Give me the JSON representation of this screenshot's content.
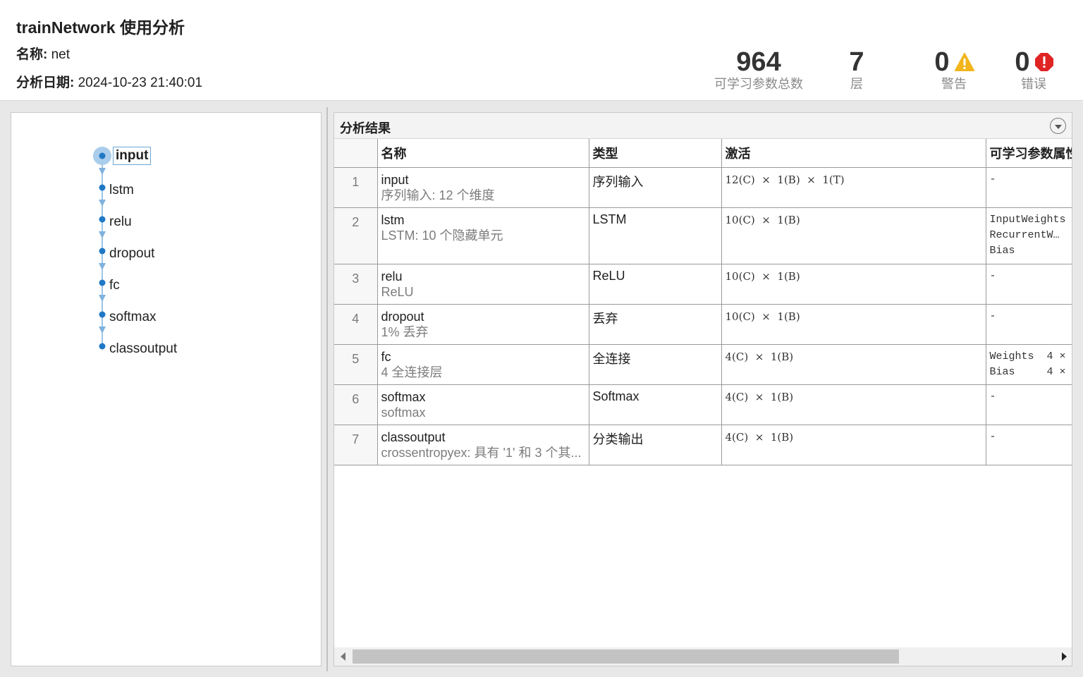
{
  "header": {
    "title": "trainNetwork 使用分析",
    "name_label": "名称:",
    "name_value": "net",
    "date_label": "分析日期:",
    "date_value": "2024-10-23 21:40:01"
  },
  "stats": {
    "params_value": "964",
    "params_label": "可学习参数总数",
    "layers_value": "7",
    "layers_label": "层",
    "warnings_value": "0",
    "warnings_label": "警告",
    "errors_value": "0",
    "errors_label": "错误",
    "warning_color": "#f2b51c",
    "error_color": "#e02424"
  },
  "graph": {
    "accent": "#1f78c4",
    "nodes": [
      "input",
      "lstm",
      "relu",
      "dropout",
      "fc",
      "softmax",
      "classoutput"
    ],
    "selected": "input"
  },
  "results": {
    "title": "分析结果",
    "columns": [
      "名称",
      "类型",
      "激活",
      "可学习参数属性"
    ],
    "rows": [
      {
        "index": "1",
        "name": "input",
        "desc": "序列输入: 12 个维度",
        "type": "序列输入",
        "activation": "12(C)  ×  1(B)  ×  1(T)",
        "learnables": "-"
      },
      {
        "index": "2",
        "name": "lstm",
        "desc": "LSTM: 10 个隐藏单元",
        "type": "LSTM",
        "activation": "10(C)  ×  1(B)",
        "learnables": "InputWeights\nRecurrentW…\nBias"
      },
      {
        "index": "3",
        "name": "relu",
        "desc": "ReLU",
        "type": "ReLU",
        "activation": "10(C)  ×  1(B)",
        "learnables": "-"
      },
      {
        "index": "4",
        "name": "dropout",
        "desc": "1% 丢弃",
        "type": "丢弃",
        "activation": "10(C)  ×  1(B)",
        "learnables": "-"
      },
      {
        "index": "5",
        "name": "fc",
        "desc": "4 全连接层",
        "type": "全连接",
        "activation": "4(C)  ×  1(B)",
        "learnables": "Weights  4 ×\nBias     4 ×"
      },
      {
        "index": "6",
        "name": "softmax",
        "desc": "softmax",
        "type": "Softmax",
        "activation": "4(C)  ×  1(B)",
        "learnables": "-"
      },
      {
        "index": "7",
        "name": "classoutput",
        "desc": "crossentropyex: 具有 '1' 和 3 个其...",
        "type": "分类输出",
        "activation": "4(C)  ×  1(B)",
        "learnables": "-"
      }
    ]
  }
}
